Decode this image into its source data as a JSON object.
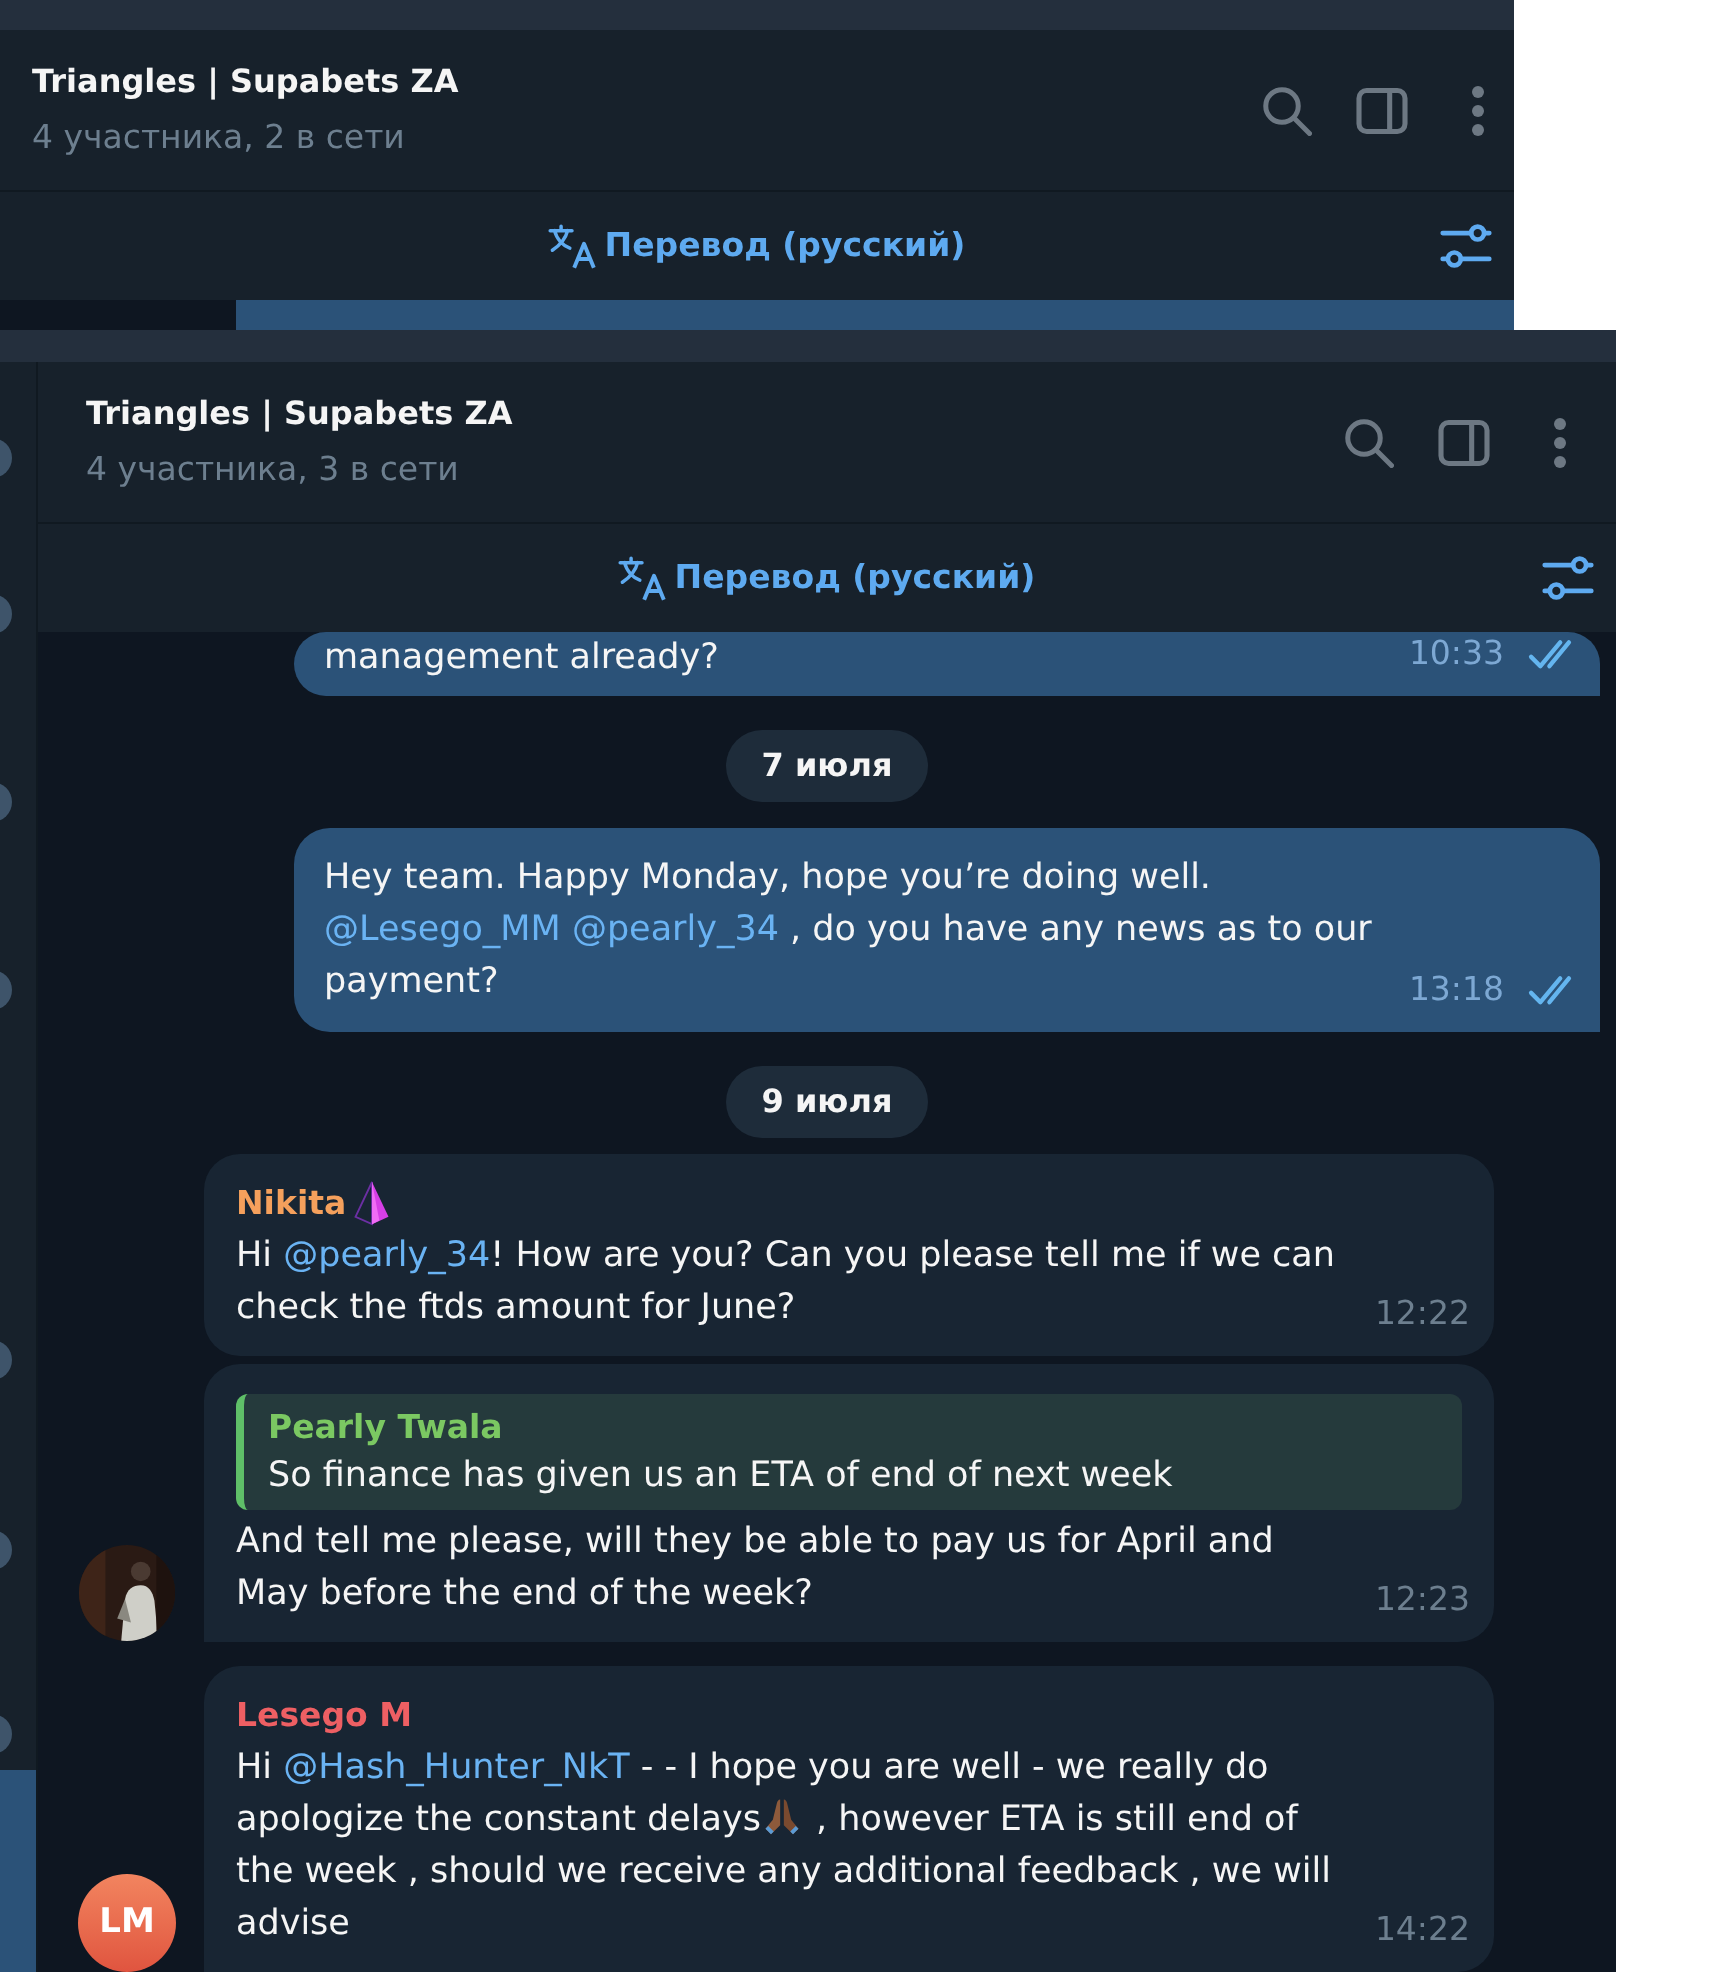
{
  "back_window": {
    "title": "Triangles | Supabets ZA",
    "subtitle": "4 участника, 2 в сети",
    "translate_label": "Перевод (русский)"
  },
  "front_window": {
    "title": "Triangles | Supabets ZA",
    "subtitle": "4 участника, 3 в сети",
    "translate_label": "Перевод (русский)",
    "messages": [
      {
        "kind": "outgoing",
        "segments": [
          {
            "kind": "text",
            "text": "management already?"
          }
        ],
        "time": "10:33",
        "read": true
      },
      {
        "kind": "date",
        "text": "7 июля"
      },
      {
        "kind": "outgoing",
        "segments": [
          {
            "kind": "text",
            "text": "Hey team. Happy Monday, hope you’re doing well. "
          },
          {
            "kind": "mention",
            "text": "@Lesego_MM"
          },
          {
            "kind": "mention",
            "text": "@pearly_34"
          },
          {
            "kind": "text",
            "text": " , do you have any news as to our payment?"
          }
        ],
        "time": "13:18",
        "read": true
      },
      {
        "kind": "date",
        "text": "9 июля"
      },
      {
        "kind": "incoming",
        "sender": "Nikita",
        "color": "#f5a05c",
        "emoji_status": true,
        "segments": [
          {
            "kind": "text",
            "text": "Hi "
          },
          {
            "kind": "mention",
            "text": "@pearly_34"
          },
          {
            "kind": "text",
            "text": "! How are you? Can you please tell me if we can check the ftds amount for June?"
          }
        ],
        "time": "12:22"
      },
      {
        "kind": "incoming",
        "reply": {
          "author": "Pearly Twala",
          "text": "So finance has given us an ETA of end of next week"
        },
        "segments": [
          {
            "kind": "text",
            "text": "And tell me please, will they be able to pay us for April and May before the end of the week?"
          }
        ],
        "time": "12:23"
      },
      {
        "kind": "incoming",
        "sender": "Lesego M",
        "color": "#ee5f63",
        "emoji_status": false,
        "avatar": {
          "kind": "initials",
          "text": "LM"
        },
        "segments": [
          {
            "kind": "text",
            "text": "Hi "
          },
          {
            "kind": "mention",
            "text": "@Hash_Hunter_NkT"
          },
          {
            "kind": "text",
            "text": " - - I hope you are well - we really do apologize the constant delays"
          },
          {
            "kind": "emoji"
          },
          {
            "kind": "text",
            "text": " , however ETA is still end of the week , should we receive any additional feedback , we will advise"
          }
        ],
        "time": "14:22"
      }
    ]
  }
}
